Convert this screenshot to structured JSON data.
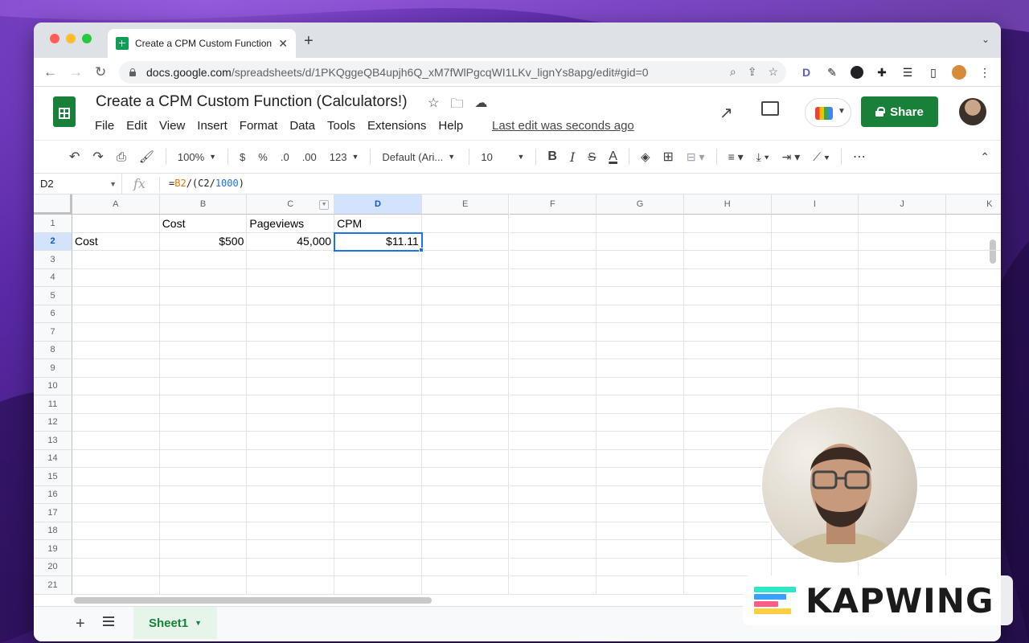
{
  "browser": {
    "tab_title": "Create a CPM Custom Function",
    "url_host": "docs.google.com",
    "url_path": "/spreadsheets/d/1PKQggeQB4upjh6Q_xM7fWlPgcqWI1LKv_lignYs8apg/edit#gid=0",
    "ext_d_label": "D"
  },
  "doc": {
    "title": "Create a CPM Custom Function (Calculators!)",
    "menu": [
      "File",
      "Edit",
      "View",
      "Insert",
      "Format",
      "Data",
      "Tools",
      "Extensions",
      "Help"
    ],
    "last_edit": "Last edit was seconds ago",
    "share_label": "Share"
  },
  "toolbar": {
    "zoom": "100%",
    "currency": "$",
    "percent": "%",
    "dec_decrease": ".0",
    "dec_increase": ".00",
    "number_format": "123",
    "font": "Default (Ari...",
    "font_size": "10",
    "bold": "B",
    "italic": "I",
    "strike": "S",
    "text_color": "A",
    "more": "⋯"
  },
  "formula_bar": {
    "name_box": "D2",
    "fx": "fx",
    "formula_prefix": "=",
    "formula_ref1": "B2",
    "formula_mid": "/(C2/",
    "formula_num": "1000",
    "formula_end": ")"
  },
  "grid": {
    "columns": [
      "A",
      "B",
      "C",
      "D",
      "E",
      "F",
      "G",
      "H",
      "I",
      "J",
      "K"
    ],
    "rows": [
      "1",
      "2",
      "3",
      "4",
      "5",
      "6",
      "7",
      "8",
      "9",
      "10",
      "11",
      "12",
      "13",
      "14",
      "15",
      "16",
      "17",
      "18",
      "19",
      "20",
      "21"
    ],
    "cells": {
      "B1": "Cost",
      "C1": "Pageviews",
      "D1": "CPM",
      "A2": "Cost",
      "B2": "$500",
      "C2": "45,000",
      "D2": "$11.11"
    },
    "selected_cell": "D2"
  },
  "sheets": {
    "add_label": "+",
    "tabs": [
      "Sheet1"
    ]
  },
  "overlay": {
    "brand": "KAPWING",
    "logo_colors": [
      "#2ee6c8",
      "#ff5c8a",
      "#ffcf3f",
      "#3aa0ff"
    ]
  }
}
